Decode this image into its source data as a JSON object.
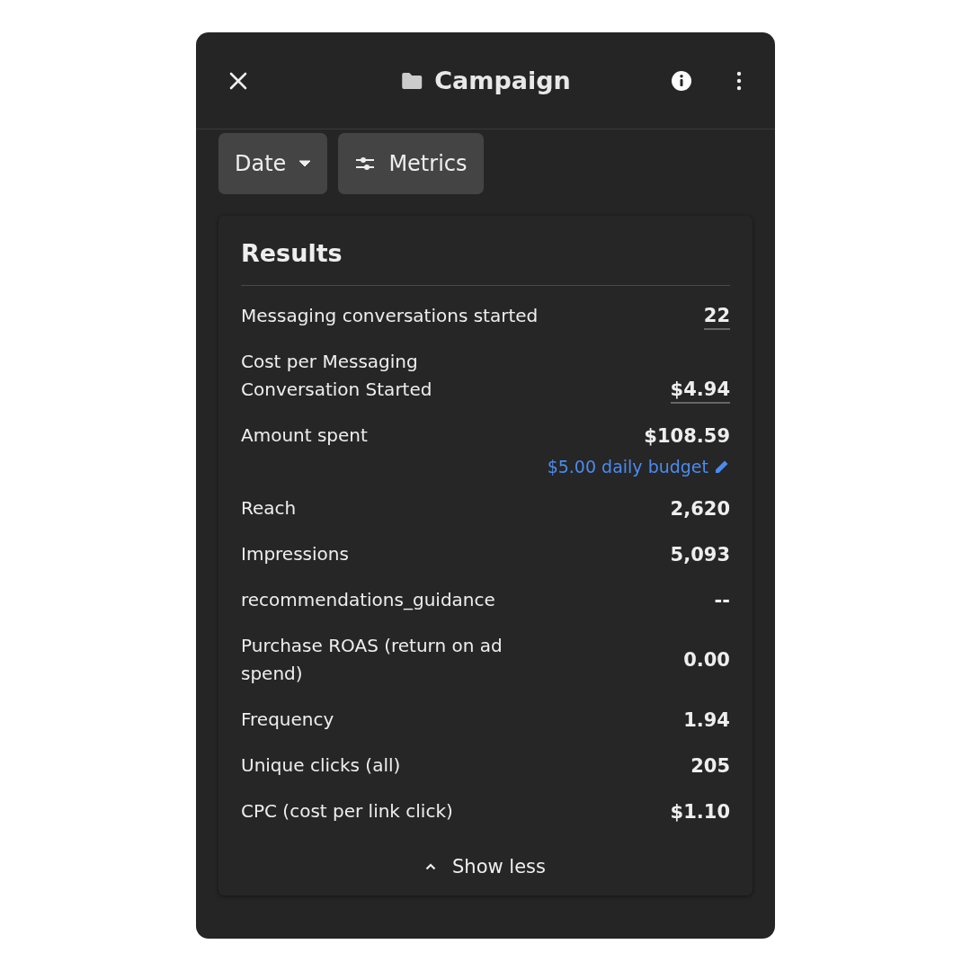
{
  "header": {
    "title": "Campaign"
  },
  "filters": [
    {
      "label": "Date",
      "kind": "dropdown"
    },
    {
      "label": "Metrics",
      "kind": "settings"
    }
  ],
  "results": {
    "title": "Results",
    "rows": [
      {
        "label": "Messaging conversations started",
        "value": "22",
        "underlined": true
      },
      {
        "label": "Cost per Messaging\nConversation Started",
        "value": "$4.94",
        "underlined": true
      },
      {
        "label": "Amount spent",
        "value": "$108.59",
        "underlined": false,
        "link": "$5.00 daily budget"
      },
      {
        "label": "Reach",
        "value": "2,620",
        "underlined": false
      },
      {
        "label": "Impressions",
        "value": "5,093",
        "underlined": false
      },
      {
        "label": "recommendations_guidance",
        "value": "--",
        "underlined": false
      },
      {
        "label": "Purchase ROAS (return on ad\nspend)",
        "value": "0.00",
        "underlined": false
      },
      {
        "label": "Frequency",
        "value": "1.94",
        "underlined": false
      },
      {
        "label": "Unique clicks (all)",
        "value": "205",
        "underlined": false
      },
      {
        "label": "CPC (cost per link click)",
        "value": "$1.10",
        "underlined": false
      }
    ],
    "toggle": "Show less"
  }
}
